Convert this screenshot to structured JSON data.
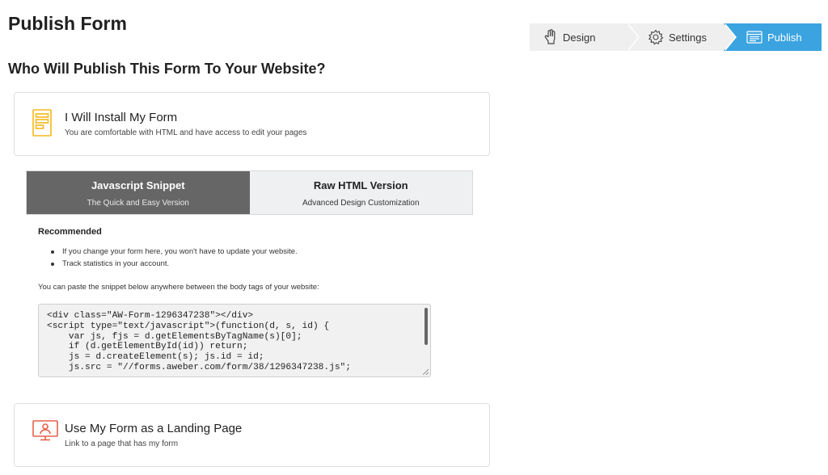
{
  "page": {
    "title": "Publish Form",
    "subheading": "Who Will Publish This Form To Your Website?"
  },
  "stepper": {
    "steps": [
      {
        "label": "Design",
        "icon": "hand-pointer-icon",
        "active": false
      },
      {
        "label": "Settings",
        "icon": "gear-icon",
        "active": false
      },
      {
        "label": "Publish",
        "icon": "browser-window-icon",
        "active": true
      }
    ],
    "active_color": "#3aa3e0",
    "inactive_color": "#efefef"
  },
  "options": {
    "install": {
      "title": "I Will Install My Form",
      "description": "You are comfortable with HTML and have access to edit your pages",
      "icon": "form-document-icon",
      "icon_color": "#f5b71a"
    },
    "landing": {
      "title": "Use My Form as a Landing Page",
      "description": "Link to a page that has my form",
      "icon": "landing-page-user-icon",
      "icon_color": "#e8614a"
    }
  },
  "tabs": [
    {
      "title": "Javascript Snippet",
      "subtitle": "The Quick and Easy Version",
      "active": true
    },
    {
      "title": "Raw HTML Version",
      "subtitle": "Advanced Design Customization",
      "active": false
    }
  ],
  "snippet_panel": {
    "recommended_label": "Recommended",
    "bullets": [
      "If you change your form here, you won't have to update your website.",
      "Track statistics in your account."
    ],
    "paste_note": "You can paste the snippet below anywhere between the body tags of your website:",
    "code": "<div class=\"AW-Form-1296347238\"></div>\n<script type=\"text/javascript\">(function(d, s, id) {\n    var js, fjs = d.getElementsByTagName(s)[0];\n    if (d.getElementById(id)) return;\n    js = d.createElement(s); js.id = id;\n    js.src = \"//forms.aweber.com/form/38/1296347238.js\";"
  }
}
